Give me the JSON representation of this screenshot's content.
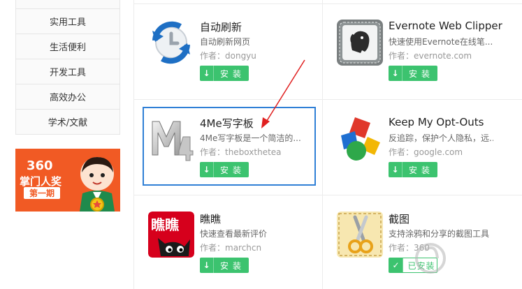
{
  "sidebar": {
    "items": [
      {
        "label": "实用工具"
      },
      {
        "label": "生活便利"
      },
      {
        "label": "开发工具"
      },
      {
        "label": "高效办公"
      },
      {
        "label": "学术/文献"
      }
    ]
  },
  "banner": {
    "number": "360",
    "line1": "掌门人奖",
    "line2": "第一期"
  },
  "extensions": [
    {
      "name": "自动刷新",
      "desc": "自动刷新网页",
      "author": "作者：dongyu",
      "button": "安装",
      "icon": "clock-refresh-icon",
      "installed": false
    },
    {
      "name": "Evernote Web Clipper",
      "desc": "快速使用Evernote在线笔...",
      "author": "作者：evernote.com",
      "button": "安装",
      "icon": "evernote-elephant-icon",
      "installed": false
    },
    {
      "name": "4Me写字板",
      "desc": "4Me写字板是一个简洁的...",
      "author": "作者：theboxthetea",
      "button": "安装",
      "icon": "m4-logo-icon",
      "installed": false
    },
    {
      "name": "Keep My Opt-Outs",
      "desc": "反追踪，保护个人隐私，远...",
      "author": "作者：google.com",
      "button": "安装",
      "icon": "google-shapes-icon",
      "installed": false
    },
    {
      "name": "瞧瞧",
      "desc": "快速查看最新评价",
      "author": "作者：marchcn",
      "button": "安装",
      "icon": "tmall-cat-icon",
      "installed": false
    },
    {
      "name": "截图",
      "desc": "支持涂鸦和分享的截图工具",
      "author": "作者：360",
      "button": "已安装",
      "icon": "scissors-icon",
      "installed": true
    }
  ],
  "colors": {
    "install_green": "#3cc36f",
    "highlight_blue": "#2f7fd6",
    "annotation_red": "#e02020",
    "banner_orange": "#f15a24"
  }
}
